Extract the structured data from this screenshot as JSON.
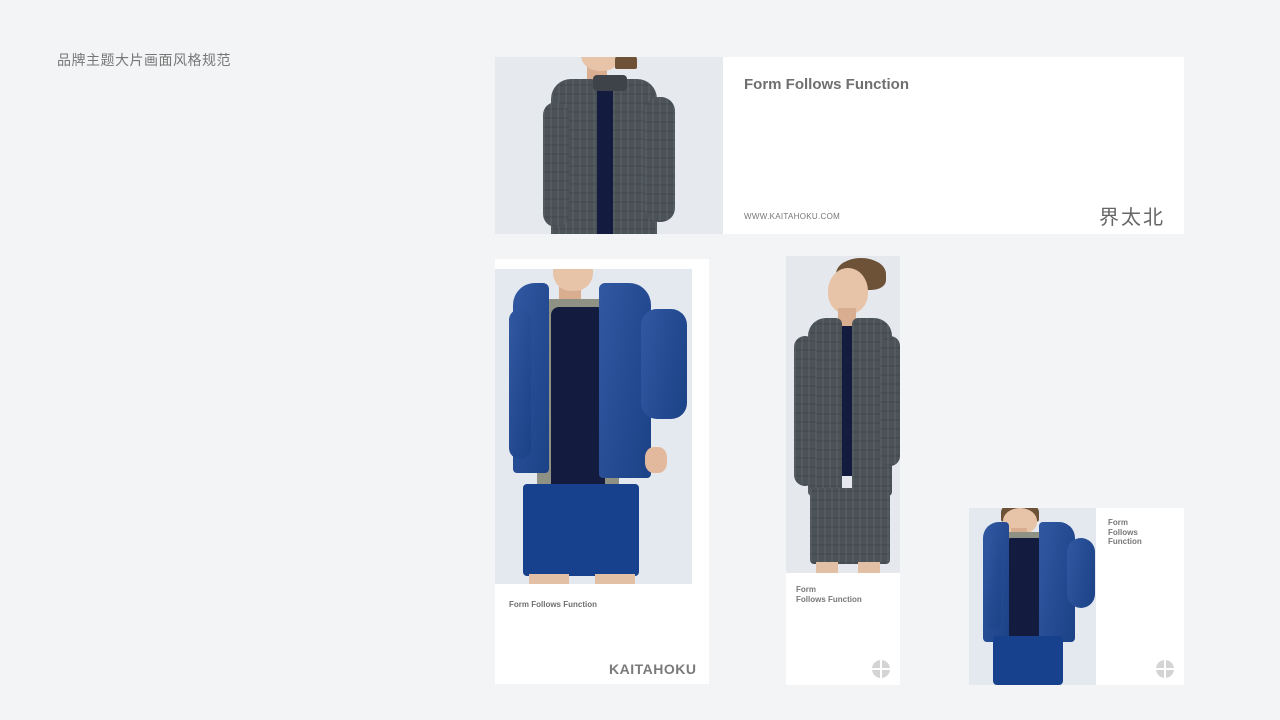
{
  "page": {
    "title": "品牌主题大片画面风格规范"
  },
  "banner": {
    "headline": "Form Follows Function",
    "url": "WWW.KAITAHOKU.COM",
    "logo_cjk": "界太北"
  },
  "poster_large": {
    "tagline": "Form Follows Function",
    "brand": "KAITAHOKU"
  },
  "poster_narrow": {
    "tagline": "Form\nFollows Function"
  },
  "poster_small": {
    "tagline": "Form\nFollows\nFunction"
  },
  "icons": {
    "emblem": "circle-cross-emblem-icon"
  }
}
